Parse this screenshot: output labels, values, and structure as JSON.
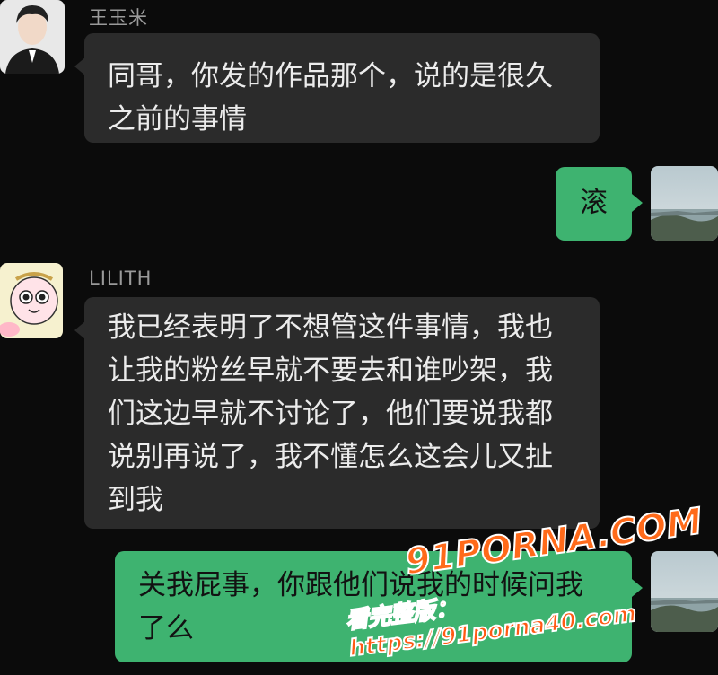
{
  "messages": [
    {
      "sender": "王玉米",
      "text": "同哥，你发的作品那个，说的是很久\n之前的事情"
    },
    {
      "text": "滚"
    },
    {
      "sender": "LILITH",
      "text": "我已经表明了不想管这件事情，我也\n让我的粉丝早就不要去和谁吵架，我\n们这边早就不讨论了，他们要说我都\n说别再说了，我不懂怎么这会儿又扯\n到我"
    },
    {
      "text": "关我屁事，你跟他们说我的时候问我\n了么"
    }
  ],
  "watermark": {
    "logo": "91PORNA.COM",
    "url": "看完整版：https://91porna40.com"
  },
  "colors": {
    "background": "#0b0b0b",
    "incoming_bubble": "#2b2b2b",
    "outgoing_bubble": "#3eb370",
    "watermark": "#ff5a14"
  }
}
